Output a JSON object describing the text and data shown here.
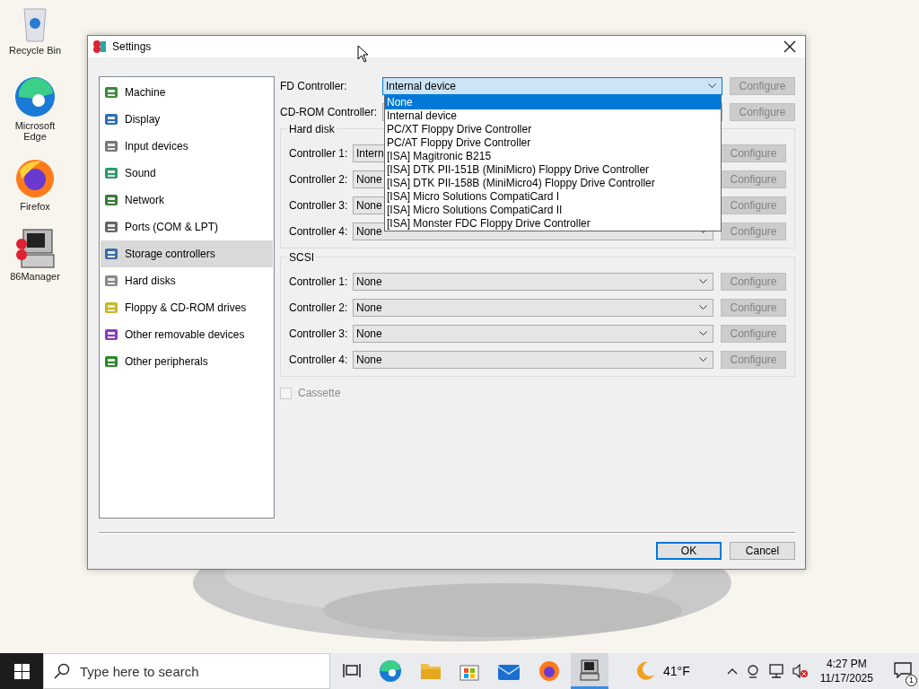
{
  "desktop_icons": [
    {
      "label": "Recycle Bin"
    },
    {
      "label": "Microsoft Edge"
    },
    {
      "label": "Firefox"
    },
    {
      "label": "86Manager"
    }
  ],
  "dialog": {
    "title": "Settings",
    "sidebar": [
      {
        "label": "Machine",
        "selected": false
      },
      {
        "label": "Display",
        "selected": false
      },
      {
        "label": "Input devices",
        "selected": false
      },
      {
        "label": "Sound",
        "selected": false
      },
      {
        "label": "Network",
        "selected": false
      },
      {
        "label": "Ports (COM & LPT)",
        "selected": false
      },
      {
        "label": "Storage controllers",
        "selected": true
      },
      {
        "label": "Hard disks",
        "selected": false
      },
      {
        "label": "Floppy & CD-ROM drives",
        "selected": false
      },
      {
        "label": "Other removable devices",
        "selected": false
      },
      {
        "label": "Other peripherals",
        "selected": false
      }
    ],
    "fd_controller": {
      "label": "FD Controller:",
      "value": "Internal device",
      "button": "Configure",
      "button_disabled": true,
      "open": true
    },
    "fd_options": [
      {
        "label": "None",
        "selected": true
      },
      {
        "label": "Internal device",
        "selected": false
      },
      {
        "label": "PC/XT Floppy Drive Controller",
        "selected": false
      },
      {
        "label": "PC/AT Floppy Drive Controller",
        "selected": false
      },
      {
        "label": "[ISA] Magitronic B215",
        "selected": false
      },
      {
        "label": "[ISA] DTK PII-151B (MiniMicro) Floppy Drive Controller",
        "selected": false
      },
      {
        "label": "[ISA] DTK PII-158B (MiniMicro4) Floppy Drive Controller",
        "selected": false
      },
      {
        "label": "[ISA] Micro Solutions CompatiCard I",
        "selected": false
      },
      {
        "label": "[ISA] Micro Solutions CompatiCard II",
        "selected": false
      },
      {
        "label": "[ISA] Monster FDC Floppy Drive Controller",
        "selected": false
      }
    ],
    "cdrom_controller": {
      "label": "CD-ROM Controller:",
      "button": "Configure",
      "button_disabled": true
    },
    "groups": [
      {
        "title": "Hard disk",
        "controllers": [
          {
            "label": "Controller 1:",
            "value": "Intern",
            "button": "Configure",
            "button_disabled": true,
            "covered": true
          },
          {
            "label": "Controller 2:",
            "value": "None",
            "button": "Configure",
            "button_disabled": true,
            "covered": true
          },
          {
            "label": "Controller 3:",
            "value": "None",
            "button": "Configure",
            "button_disabled": true,
            "covered": true
          },
          {
            "label": "Controller 4:",
            "value": "None",
            "button": "Configure",
            "button_disabled": true,
            "covered": false
          }
        ]
      },
      {
        "title": "SCSI",
        "controllers": [
          {
            "label": "Controller 1:",
            "value": "None",
            "button": "Configure",
            "button_disabled": true
          },
          {
            "label": "Controller 2:",
            "value": "None",
            "button": "Configure",
            "button_disabled": true
          },
          {
            "label": "Controller 3:",
            "value": "None",
            "button": "Configure",
            "button_disabled": true
          },
          {
            "label": "Controller 4:",
            "value": "None",
            "button": "Configure",
            "button_disabled": true
          }
        ]
      }
    ],
    "cassette": {
      "label": "Cassette",
      "checked": false,
      "disabled": true
    },
    "buttons": [
      {
        "label": "OK",
        "kind": "default"
      },
      {
        "label": "Cancel",
        "kind": "normal"
      }
    ]
  },
  "taskbar": {
    "search_placeholder": "Type here to search",
    "temperature": "41°F",
    "time": "4:27 PM",
    "date": "11/17/2025",
    "notification_count": "1"
  }
}
